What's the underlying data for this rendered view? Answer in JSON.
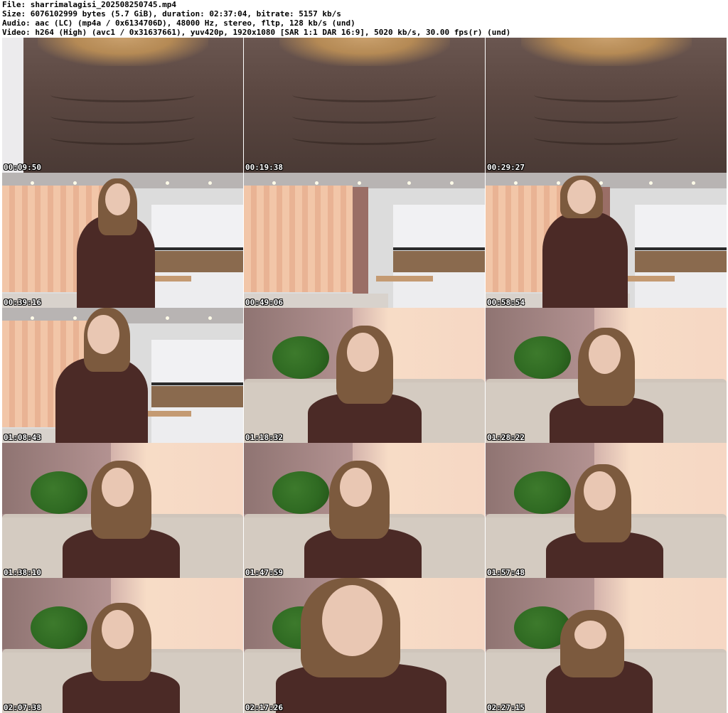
{
  "header": {
    "file": "File: sharrimalagisi_202508250745.mp4",
    "size": "Size: 6076102999 bytes (5.7 GiB), duration: 02:37:04, bitrate: 5157 kb/s",
    "audio": "Audio: aac (LC) (mp4a / 0x6134706D), 48000 Hz, stereo, fltp, 128 kb/s (und)",
    "video": "Video: h264 (High) (avc1 / 0x31637661), yuv420p, 1920x1080 [SAR 1:1 DAR 16:9], 5020 kb/s, 30.00 fps(r) (und)"
  },
  "thumbnails": [
    {
      "timestamp": "00:09:50",
      "scene": "closeup"
    },
    {
      "timestamp": "00:19:38",
      "scene": "closeup"
    },
    {
      "timestamp": "00:29:27",
      "scene": "closeup"
    },
    {
      "timestamp": "00:39:16",
      "scene": "room"
    },
    {
      "timestamp": "00:49:06",
      "scene": "room"
    },
    {
      "timestamp": "00:58:54",
      "scene": "room"
    },
    {
      "timestamp": "01:08:43",
      "scene": "room"
    },
    {
      "timestamp": "01:18:32",
      "scene": "couch"
    },
    {
      "timestamp": "01:28:22",
      "scene": "couch"
    },
    {
      "timestamp": "01:38:10",
      "scene": "couch"
    },
    {
      "timestamp": "01:47:59",
      "scene": "couch"
    },
    {
      "timestamp": "01:57:48",
      "scene": "couch"
    },
    {
      "timestamp": "02:07:38",
      "scene": "couch"
    },
    {
      "timestamp": "02:17:26",
      "scene": "couch"
    },
    {
      "timestamp": "02:27:15",
      "scene": "couch"
    }
  ]
}
